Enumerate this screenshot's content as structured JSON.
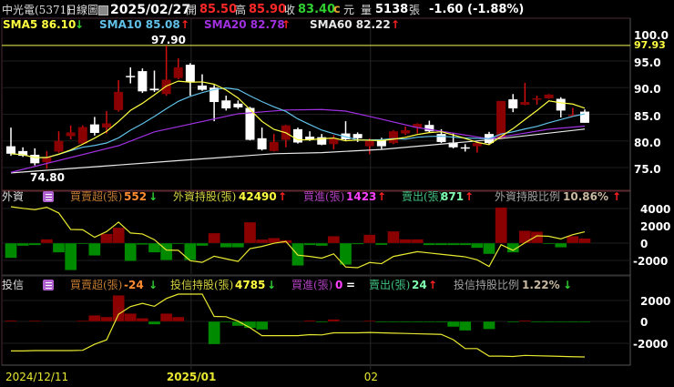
{
  "header": {
    "stock_name": "中光電(5371)",
    "chart_kind": "日線圖",
    "date": "2025/02/27",
    "open_label": "開",
    "open": "85.50",
    "high_label": "高",
    "high": "85.90",
    "close_label": "收",
    "close": "83.40",
    "c_mark": "c",
    "currency": "元",
    "volume_label": "量",
    "volume": "5138",
    "volume_unit": "張",
    "change": "-1.60 (-1.88%)"
  },
  "sma_legend": [
    {
      "label": "SMA5 86.10",
      "arrow": "↓",
      "color": "#ffff40",
      "arrow_color": "#30d030"
    },
    {
      "label": "SMA10 85.08",
      "arrow": "↑",
      "color": "#60c0e8",
      "arrow_color": "#ff2020"
    },
    {
      "label": "SMA20 82.78",
      "arrow": "↑",
      "color": "#a030e0",
      "arrow_color": "#ff2020"
    },
    {
      "label": "SMA60 82.22",
      "arrow": "↑",
      "color": "#e8e8e8",
      "arrow_color": "#ff2020"
    }
  ],
  "foreign": {
    "title": "外資",
    "net_label": "買賣超(張)",
    "net_value": "552",
    "net_arrow": "↓",
    "hold_label": "外資持股(張)",
    "hold_value": "42490",
    "hold_arrow": "↑",
    "buy_label": "買進(張)",
    "buy_value": "1423",
    "buy_arrow": "↑",
    "sell_label": "賣出(張)",
    "sell_value": "871",
    "sell_arrow": "↑",
    "ratio_label": "外資持股比例",
    "ratio_value": "10.86%",
    "ratio_arrow": "↑"
  },
  "trust": {
    "title": "投信",
    "net_label": "買賣超(張)",
    "net_value": "-24",
    "net_arrow": "↓",
    "hold_label": "投信持股(張)",
    "hold_value": "4785",
    "hold_arrow": "↓",
    "buy_label": "買進(張)",
    "buy_value": "0",
    "buy_arrow": "=",
    "sell_label": "賣出(張)",
    "sell_value": "24",
    "sell_arrow": "↑",
    "ratio_label": "投信持股比例",
    "ratio_value": "1.22%",
    "ratio_arrow": "↓"
  },
  "colors": {
    "up": "#8b0000",
    "down": "#ffffff",
    "buy_bar": "#8b0000",
    "sell_bar": "#008a00",
    "line": "#e8e830",
    "highline": "#c8c840"
  },
  "chart_data": [
    {
      "type": "candlestick",
      "title": "",
      "ylim": [
        72,
        100
      ],
      "yticks": [
        "100.0",
        "95.0",
        "90.0",
        "85.0",
        "80.0",
        "75.0"
      ],
      "max_marker": "97.90",
      "min_marker": "74.80",
      "high_line": "97.93",
      "xtick_labels": [
        "2024/12/11",
        "2025/01",
        "02"
      ],
      "xtick_index": [
        0,
        15,
        30
      ],
      "ohlc": [
        [
          79.0,
          82.5,
          77.2,
          77.6
        ],
        [
          78.1,
          78.8,
          77.0,
          77.2
        ],
        [
          77.4,
          78.6,
          75.4,
          75.8
        ],
        [
          76.0,
          78.1,
          74.8,
          76.9
        ],
        [
          78.0,
          81.8,
          77.8,
          80.0
        ],
        [
          80.9,
          82.9,
          80.3,
          81.6
        ],
        [
          79.5,
          82.9,
          79.3,
          82.6
        ],
        [
          83.1,
          84.5,
          81.0,
          81.5
        ],
        [
          82.5,
          85.6,
          81.4,
          83.3
        ],
        [
          85.8,
          91.4,
          85.5,
          89.2
        ],
        [
          92.2,
          93.8,
          90.8,
          92.0
        ],
        [
          93.1,
          93.6,
          89.0,
          89.3
        ],
        [
          89.8,
          93.2,
          89.2,
          89.5
        ],
        [
          88.8,
          97.9,
          88.5,
          91.5
        ],
        [
          91.8,
          95.5,
          91.6,
          93.8
        ],
        [
          94.3,
          94.6,
          88.5,
          91.0
        ],
        [
          90.4,
          92.5,
          89.4,
          89.6
        ],
        [
          90.0,
          90.5,
          83.7,
          87.3
        ],
        [
          87.6,
          88.5,
          85.7,
          86.1
        ],
        [
          87.0,
          87.6,
          86.0,
          86.3
        ],
        [
          86.2,
          86.4,
          80.1,
          80.2
        ],
        [
          80.5,
          82.5,
          78.2,
          78.4
        ],
        [
          78.1,
          81.3,
          78.0,
          79.8
        ],
        [
          80.2,
          83.0,
          78.8,
          82.9
        ],
        [
          82.2,
          82.5,
          79.5,
          79.7
        ],
        [
          80.8,
          81.8,
          80.0,
          80.3
        ],
        [
          80.7,
          81.3,
          79.2,
          79.3
        ],
        [
          79.4,
          81.1,
          78.4,
          80.5
        ],
        [
          81.4,
          83.7,
          80.0,
          80.3
        ],
        [
          81.3,
          81.6,
          79.8,
          80.5
        ],
        [
          79.0,
          80.5,
          77.5,
          80.0
        ],
        [
          80.2,
          80.6,
          78.5,
          79.0
        ],
        [
          79.6,
          82.0,
          79.4,
          81.8
        ],
        [
          81.4,
          82.7,
          81.1,
          82.0
        ],
        [
          82.5,
          83.3,
          81.4,
          83.2
        ],
        [
          83.0,
          83.8,
          81.6,
          81.8
        ],
        [
          81.3,
          82.2,
          79.6,
          79.8
        ],
        [
          79.7,
          81.5,
          78.6,
          78.8
        ],
        [
          78.8,
          79.4,
          78.0,
          78.7
        ],
        [
          79.0,
          79.8,
          77.8,
          79.6
        ],
        [
          81.3,
          81.7,
          79.4,
          79.6
        ],
        [
          80.5,
          87.5,
          80.3,
          87.5
        ],
        [
          87.8,
          88.8,
          85.4,
          86.1
        ],
        [
          86.8,
          90.9,
          86.7,
          87.3
        ],
        [
          87.8,
          88.5,
          86.8,
          88.0
        ],
        [
          88.0,
          88.8,
          87.9,
          88.7
        ],
        [
          87.9,
          88.2,
          84.4,
          85.7
        ],
        [
          84.7,
          86.2,
          84.6,
          84.9
        ],
        [
          85.5,
          85.9,
          83.4,
          83.4
        ]
      ],
      "sma20_points": [
        [
          0,
          74.1
        ],
        [
          9,
          79.1
        ],
        [
          12,
          81.7
        ],
        [
          19,
          85.1
        ],
        [
          23,
          85.8
        ],
        [
          26,
          85.9
        ],
        [
          28,
          85.6
        ],
        [
          30,
          84.6
        ],
        [
          34,
          82.5
        ],
        [
          40,
          80.4
        ],
        [
          42,
          81.1
        ],
        [
          45,
          82.2
        ],
        [
          48,
          82.78
        ]
      ],
      "sma60_points": [
        [
          0,
          74.0
        ],
        [
          14,
          76.3
        ],
        [
          22,
          77.6
        ],
        [
          26,
          77.8
        ],
        [
          31,
          78.4
        ],
        [
          36,
          79.4
        ],
        [
          40,
          80.2
        ],
        [
          48,
          82.22
        ]
      ]
    },
    {
      "type": "bar+line",
      "title": "外資",
      "yticks": [
        "4000",
        "2000",
        "0",
        "-2000"
      ],
      "ylim": [
        -3000,
        4500
      ],
      "net": [
        -1750,
        -320,
        -250,
        460,
        -1100,
        -3170,
        -50,
        -1460,
        1100,
        1820,
        -2100,
        -180,
        -1100,
        -2000,
        -50,
        -2000,
        -320,
        1180,
        -500,
        -500,
        2460,
        430,
        600,
        360,
        -2640,
        -250,
        -320,
        820,
        -2530,
        -140,
        1000,
        -220,
        1390,
        460,
        460,
        -250,
        -250,
        -250,
        -250,
        -570,
        -1280,
        4200,
        -1100,
        1460,
        1350,
        -100,
        -500,
        820,
        552
      ],
      "holding_last": 42490
    },
    {
      "type": "bar+line",
      "title": "投信",
      "yticks": [
        "2000",
        "0",
        "-2000"
      ],
      "ylim": [
        -3000,
        2500
      ],
      "net": [
        100,
        0,
        30,
        0,
        0,
        0,
        30,
        570,
        420,
        2430,
        740,
        300,
        -280,
        740,
        420,
        0,
        0,
        -2120,
        -30,
        -420,
        -620,
        -760,
        0,
        0,
        0,
        100,
        -30,
        200,
        0,
        0,
        30,
        -30,
        -30,
        -30,
        -30,
        -30,
        -30,
        -500,
        -850,
        0,
        -720,
        0,
        -30,
        100,
        -30,
        -30,
        -30,
        -30,
        -24
      ],
      "holding_last": 4785
    }
  ]
}
